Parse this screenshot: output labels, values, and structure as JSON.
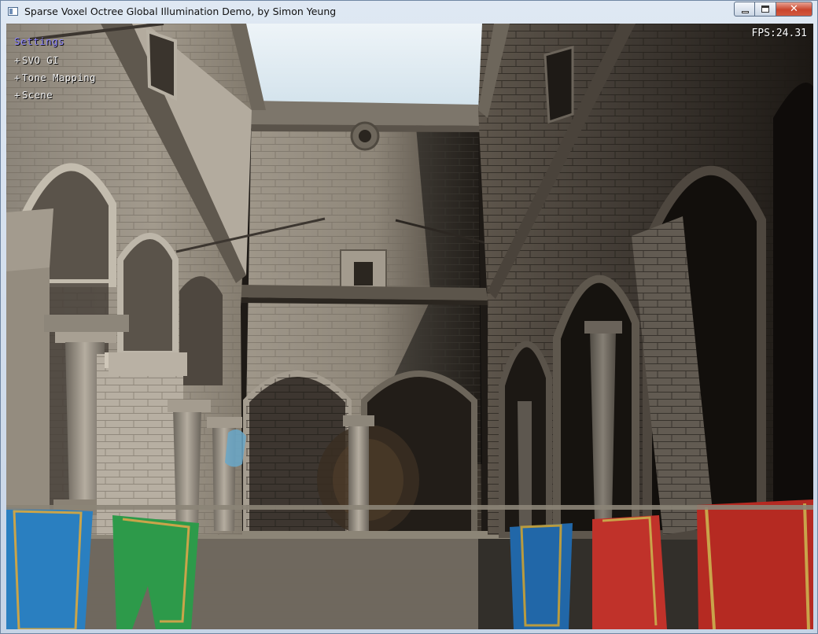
{
  "window": {
    "title": "Sparse Voxel Octree Global Illumination Demo, by Simon Yeung",
    "minimize_label": "minimize",
    "maximize_label": "maximize",
    "close_label": "✕"
  },
  "hud": {
    "menu_title": "Settings",
    "menu_items": [
      {
        "label": "SVO GI",
        "expand": "+"
      },
      {
        "label": "Tone Mapping",
        "expand": "+"
      },
      {
        "label": "Scene",
        "expand": "+"
      }
    ],
    "fps_label": "FPS:",
    "fps_value": "24.31",
    "menu_title_color": "#8e86ff"
  },
  "scene": {
    "description_icon": "rendered-3d-scene",
    "banner_colors": [
      "#2a7fc0",
      "#2d9a4a",
      "#c0322a",
      "#b52a22"
    ]
  }
}
